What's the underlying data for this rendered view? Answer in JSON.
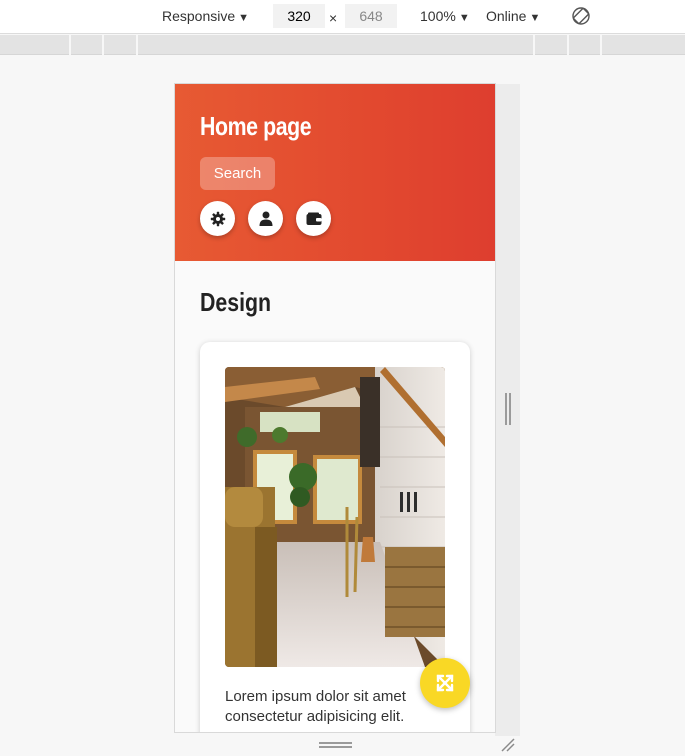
{
  "devtools": {
    "device": "Responsive",
    "width": "320",
    "times": "×",
    "height": "648",
    "zoom": "100%",
    "network": "Online",
    "icons": [
      "rotate-icon",
      "dropdown-arrow-icon"
    ]
  },
  "page": {
    "header": {
      "title": "Home page",
      "search_label": "Search",
      "icon_buttons": [
        "gear-icon",
        "user-icon",
        "wallet-icon"
      ],
      "gradient_colors": [
        "#e75a33",
        "#de3e2f"
      ]
    },
    "section_title": "Design",
    "card": {
      "image": "living-room-photo",
      "text": "Lorem ipsum dolor sit amet consectetur adipisicing elit."
    },
    "fab": {
      "icon": "expand-icon",
      "color": "#f9d825"
    }
  }
}
